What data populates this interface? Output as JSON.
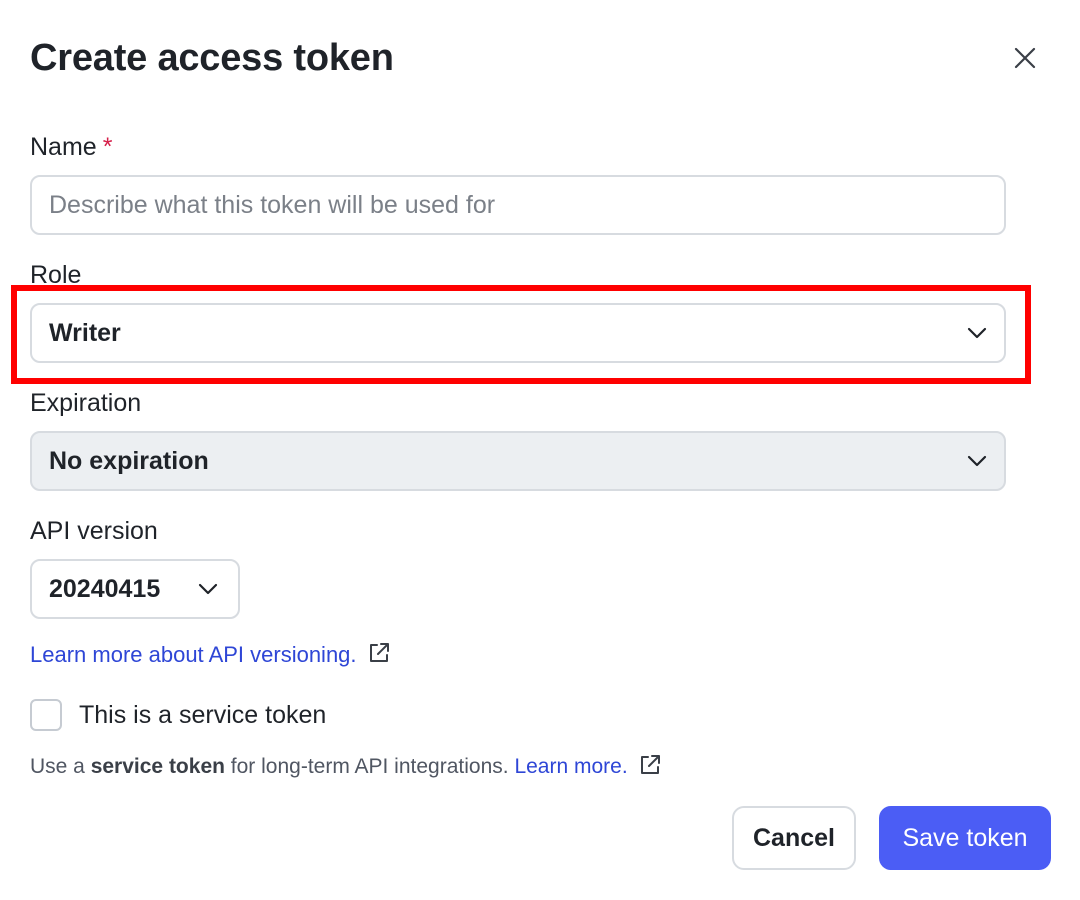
{
  "dialog": {
    "title": "Create access token",
    "close_icon": "close-icon"
  },
  "form": {
    "name": {
      "label": "Name",
      "required_marker": "*",
      "placeholder": "Describe what this token will be used for",
      "value": ""
    },
    "role": {
      "label": "Role",
      "selected": "Writer"
    },
    "expiration": {
      "label": "Expiration",
      "selected": "No expiration"
    },
    "api_version": {
      "label": "API version",
      "selected": "20240415",
      "learn_more_link": "Learn more about API versioning."
    },
    "service_token": {
      "checkbox_label": "This is a service token",
      "checked": false,
      "help_prefix": "Use a ",
      "help_bold": "service token",
      "help_suffix": " for long-term API integrations.",
      "help_link": "Learn more."
    }
  },
  "actions": {
    "cancel_label": "Cancel",
    "save_label": "Save token"
  },
  "colors": {
    "accent": "#4b5df5",
    "link": "#2e46d6",
    "required": "#d6204a",
    "highlight": "#ff0000",
    "disabled_field_bg": "#eceff2"
  }
}
